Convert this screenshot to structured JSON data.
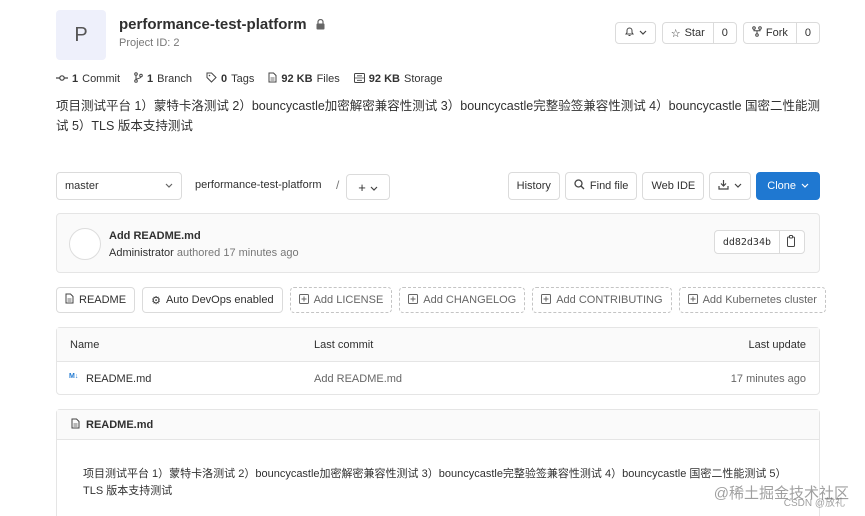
{
  "project": {
    "avatar_letter": "P",
    "title": "performance-test-platform",
    "id_label": "Project ID: 2"
  },
  "header_buttons": {
    "star_label": "Star",
    "star_count": "0",
    "fork_label": "Fork",
    "fork_count": "0"
  },
  "stats": [
    {
      "value": "1",
      "label": "Commit",
      "icon": "commit-icon"
    },
    {
      "value": "1",
      "label": "Branch",
      "icon": "branch-icon"
    },
    {
      "value": "0",
      "label": "Tags",
      "icon": "tag-icon"
    },
    {
      "value": "92 KB",
      "label": "Files",
      "icon": "file-icon"
    },
    {
      "value": "92 KB",
      "label": "Storage",
      "icon": "storage-icon"
    }
  ],
  "description": "项目测试平台 1）蒙特卡洛测试 2）bouncycastle加密解密兼容性测试 3）bouncycastle完整验签兼容性测试 4）bouncycastle 国密二性能测试 5）TLS 版本支持测试",
  "toolbar": {
    "branch": "master",
    "breadcrumb": "performance-test-platform",
    "separator": "/",
    "plus": "+",
    "history": "History",
    "find_file": "Find file",
    "web_ide": "Web IDE",
    "clone": "Clone"
  },
  "commit": {
    "title": "Add README.md",
    "author": "Administrator",
    "meta": "authored 17 minutes ago",
    "sha": "dd82d34b"
  },
  "quick_actions": [
    {
      "label": "README",
      "icon": "file-icon",
      "style": "solid"
    },
    {
      "label": "Auto DevOps enabled",
      "icon": "gear-icon",
      "style": "solid"
    },
    {
      "label": "Add LICENSE",
      "icon": "plus-square-icon",
      "style": "dashed"
    },
    {
      "label": "Add CHANGELOG",
      "icon": "plus-square-icon",
      "style": "dashed"
    },
    {
      "label": "Add CONTRIBUTING",
      "icon": "plus-square-icon",
      "style": "dashed"
    },
    {
      "label": "Add Kubernetes cluster",
      "icon": "plus-square-icon",
      "style": "dashed"
    }
  ],
  "file_tree": {
    "columns": [
      "Name",
      "Last commit",
      "Last update"
    ],
    "rows": [
      {
        "icon_text": "M↓",
        "name": "README.md",
        "last_commit": "Add README.md",
        "last_update": "17 minutes ago"
      }
    ]
  },
  "readme": {
    "title": "README.md",
    "body": "项目测试平台 1）蒙特卡洛测试 2）bouncycastle加密解密兼容性测试 3）bouncycastle完整验签兼容性测试 4）bouncycastle 国密二性能测试 5）TLS 版本支持测试"
  },
  "watermark": {
    "line1": "@稀土掘金技术社区",
    "line2": "CSDN @放礼"
  },
  "colors": {
    "primary": "#1f78d1",
    "border": "#dbdbdb"
  }
}
